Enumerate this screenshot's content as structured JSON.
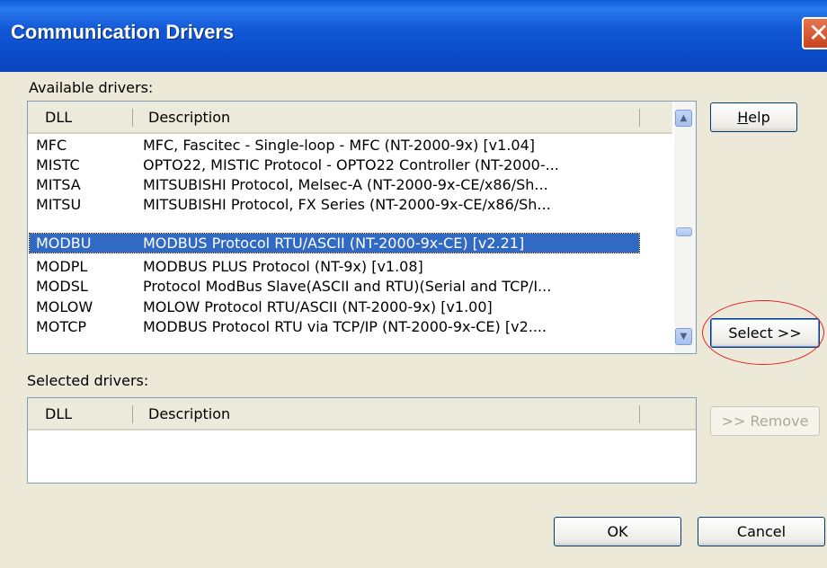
{
  "window": {
    "title": "Communication Drivers"
  },
  "available": {
    "label": "Available drivers:",
    "columns": {
      "dll": "DLL",
      "description": "Description"
    },
    "rows": [
      {
        "dll": "MFC",
        "description": "MFC, Fascitec - Single-loop - MFC (NT-2000-9x) [v1.04]"
      },
      {
        "dll": "MISTC",
        "description": "OPTO22, MISTIC Protocol - OPTO22 Controller (NT-2000-..."
      },
      {
        "dll": "MITSA",
        "description": "MITSUBISHI Protocol, Melsec-A  (NT-2000-9x-CE/x86/Sh..."
      },
      {
        "dll": "MITSU",
        "description": "MITSUBISHI Protocol, FX Series  (NT-2000-9x-CE/x86/Sh..."
      },
      {
        "dll": "MODBU",
        "description": "MODBUS Protocol RTU/ASCII (NT-2000-9x-CE) [v2.21]"
      },
      {
        "dll": "MODPL",
        "description": "MODBUS PLUS Protocol (NT-9x) [v1.08]"
      },
      {
        "dll": "MODSL",
        "description": "Protocol ModBus Slave(ASCII and RTU)(Serial and TCP/I..."
      },
      {
        "dll": "MOLOW",
        "description": "MOLOW Protocol RTU/ASCII (NT-2000-9x) [v1.00]"
      },
      {
        "dll": "MOTCP",
        "description": "MODBUS Protocol RTU via TCP/IP (NT-2000-9x-CE) [v2...."
      }
    ],
    "selected_index": 4
  },
  "selected": {
    "label": "Selected drivers:",
    "columns": {
      "dll": "DLL",
      "description": "Description"
    }
  },
  "buttons": {
    "help": {
      "pre": "",
      "accel": "H",
      "post": "elp"
    },
    "select": "Select >>",
    "remove": ">> Remove",
    "ok": "OK",
    "cancel": "Cancel"
  },
  "icons": {
    "close": "close-x-icon",
    "scroll_up": "up-arrow-icon",
    "scroll_down": "down-arrow-icon"
  },
  "colors": {
    "titlebar": "#0a4bc9",
    "selection": "#316ac5",
    "dialog_bg": "#ece9d8",
    "annotation": "#e02020"
  }
}
